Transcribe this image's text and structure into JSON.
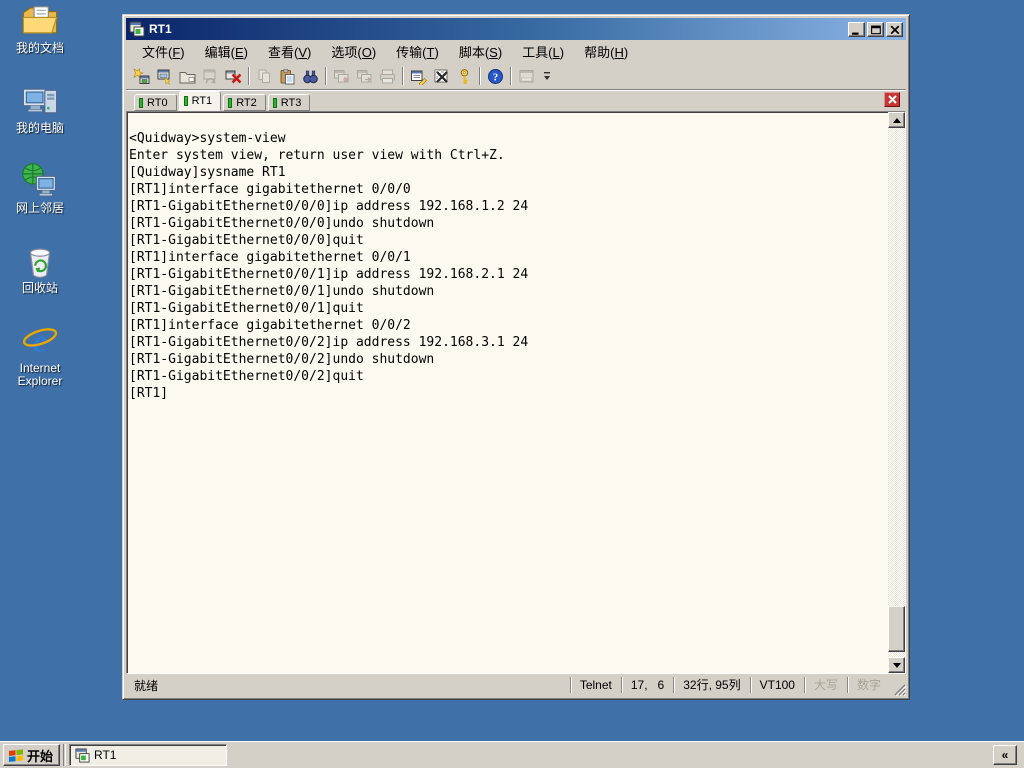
{
  "colors": {
    "desktop_background": "#3F70A8",
    "titlebar_gradient_left": "#0A246A",
    "titlebar_gradient_right": "#8CB4E6",
    "window_chrome": "#D4D0C8",
    "terminal_background": "#FCFAF0",
    "terminal_text": "#000000",
    "tab_indicator_green": "#28B828",
    "tab_close_red": "#C63838"
  },
  "desktop": {
    "icons": [
      {
        "name": "my-documents",
        "icon": "my-documents-icon",
        "label": "我的文档"
      },
      {
        "name": "my-computer",
        "icon": "my-computer-icon",
        "label": "我的电脑"
      },
      {
        "name": "network-places",
        "icon": "network-places-icon",
        "label": "网上邻居"
      },
      {
        "name": "recycle-bin",
        "icon": "recycle-bin-icon",
        "label": "回收站"
      },
      {
        "name": "internet-explorer",
        "icon": "internet-explorer-icon",
        "label": "Internet Explorer"
      }
    ]
  },
  "window": {
    "title": "RT1",
    "title_icon": "terminal-window-icon",
    "window_buttons": [
      {
        "name": "minimize-button",
        "icon": "minimize-icon"
      },
      {
        "name": "maximize-button",
        "icon": "maximize-icon"
      },
      {
        "name": "close-button",
        "icon": "close-icon"
      }
    ],
    "menu": [
      {
        "label": "文件",
        "accel": "F"
      },
      {
        "label": "编辑",
        "accel": "E"
      },
      {
        "label": "查看",
        "accel": "V"
      },
      {
        "label": "选项",
        "accel": "O"
      },
      {
        "label": "传输",
        "accel": "T"
      },
      {
        "label": "脚本",
        "accel": "S"
      },
      {
        "label": "工具",
        "accel": "L"
      },
      {
        "label": "帮助",
        "accel": "H"
      }
    ],
    "toolbar": [
      {
        "name": "quick-connect-button",
        "icon": "quick-connect-icon",
        "enabled": true
      },
      {
        "name": "connect-button",
        "icon": "connect-icon",
        "enabled": true
      },
      {
        "name": "connect-in-tab-button",
        "icon": "connect-in-tab-icon",
        "enabled": true
      },
      {
        "name": "reconnect-button",
        "icon": "reconnect-icon",
        "enabled": false
      },
      {
        "name": "disconnect-button",
        "icon": "disconnect-icon",
        "enabled": true
      },
      {
        "sep": true
      },
      {
        "name": "copy-button",
        "icon": "copy-icon",
        "enabled": false
      },
      {
        "name": "paste-button",
        "icon": "paste-icon",
        "enabled": true
      },
      {
        "name": "find-button",
        "icon": "find-icon",
        "enabled": true
      },
      {
        "sep": true
      },
      {
        "name": "previous-session-button",
        "icon": "session-tab-icon",
        "enabled": false
      },
      {
        "name": "next-session-button",
        "icon": "session-window-icon",
        "enabled": false
      },
      {
        "name": "print-button",
        "icon": "print-icon",
        "enabled": false
      },
      {
        "sep": true
      },
      {
        "name": "session-options-button",
        "icon": "session-options-icon",
        "enabled": true
      },
      {
        "name": "global-options-button",
        "icon": "global-options-icon",
        "enabled": true
      },
      {
        "name": "keymap-button",
        "icon": "keymap-icon",
        "enabled": true
      },
      {
        "sep": true
      },
      {
        "name": "help-button",
        "icon": "help-icon",
        "enabled": true
      },
      {
        "sep": true
      },
      {
        "name": "command-window-button",
        "icon": "command-window-icon",
        "enabled": false
      }
    ],
    "tabs": [
      {
        "label": "RT0",
        "active": false
      },
      {
        "label": "RT1",
        "active": true
      },
      {
        "label": "RT2",
        "active": false
      },
      {
        "label": "RT3",
        "active": false
      }
    ],
    "terminal": {
      "lines": [
        "",
        "<Quidway>system-view",
        "Enter system view, return user view with Ctrl+Z.",
        "[Quidway]sysname RT1",
        "[RT1]interface gigabitethernet 0/0/0",
        "[RT1-GigabitEthernet0/0/0]ip address 192.168.1.2 24",
        "[RT1-GigabitEthernet0/0/0]undo shutdown",
        "[RT1-GigabitEthernet0/0/0]quit",
        "[RT1]interface gigabitethernet 0/0/1",
        "[RT1-GigabitEthernet0/0/1]ip address 192.168.2.1 24",
        "[RT1-GigabitEthernet0/0/1]undo shutdown",
        "[RT1-GigabitEthernet0/0/1]quit",
        "[RT1]interface gigabitethernet 0/0/2",
        "[RT1-GigabitEthernet0/0/2]ip address 192.168.3.1 24",
        "[RT1-GigabitEthernet0/0/2]undo shutdown",
        "[RT1-GigabitEthernet0/0/2]quit",
        "[RT1]"
      ]
    },
    "status": {
      "ready": "就绪",
      "panels": [
        {
          "text": "Telnet",
          "enabled": true
        },
        {
          "text": "17,   6",
          "enabled": true
        },
        {
          "text": "32行, 95列",
          "enabled": true
        },
        {
          "text": "VT100",
          "enabled": true
        },
        {
          "text": "大写",
          "enabled": false
        },
        {
          "text": "数字",
          "enabled": false
        }
      ]
    }
  },
  "taskbar": {
    "start_label": "开始",
    "tasks": [
      {
        "label": "RT1",
        "active": true,
        "icon": "terminal-window-icon"
      }
    ],
    "overflow_label": "«"
  }
}
